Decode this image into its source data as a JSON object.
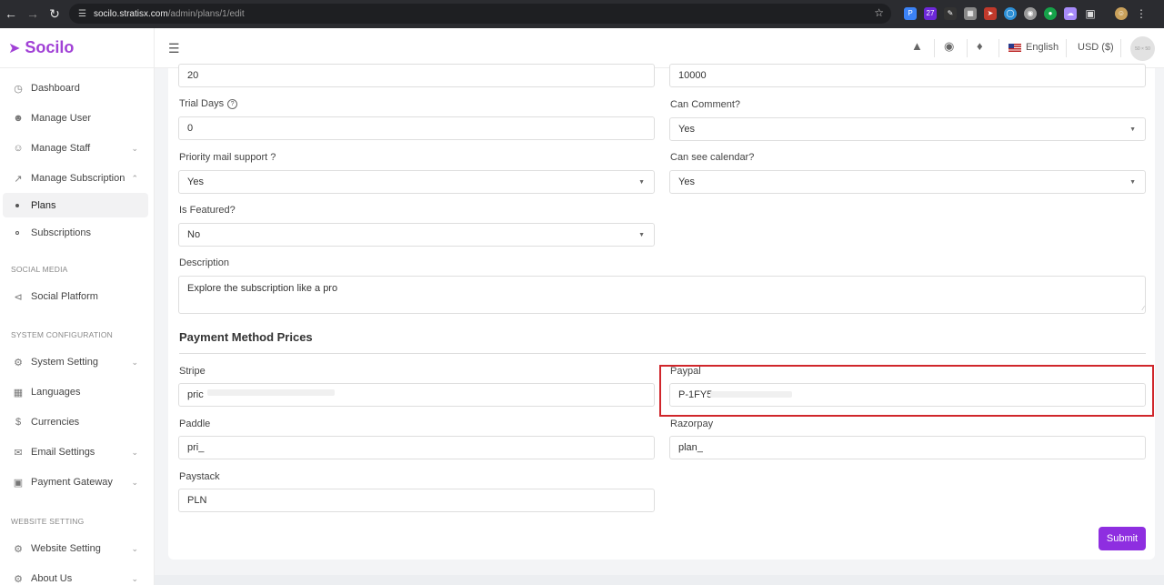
{
  "browser": {
    "url_host": "socilo.stratisx.com",
    "url_path": "/admin/plans/1/edit"
  },
  "brand": {
    "name": "Socilo",
    "accent": "#a141d6"
  },
  "sidebar": {
    "items": [
      {
        "label": "Dashboard",
        "icon": "dashboard-icon"
      },
      {
        "label": "Manage User",
        "icon": "user-icon"
      },
      {
        "label": "Manage Staff",
        "icon": "user-plus-icon"
      },
      {
        "label": "Manage Subscription",
        "icon": "chart-line-icon"
      }
    ],
    "subscription_children": [
      {
        "label": "Plans",
        "active": true
      },
      {
        "label": "Subscriptions",
        "active": false
      }
    ],
    "section_social": "SOCIAL MEDIA",
    "social_items": [
      {
        "label": "Social Platform",
        "icon": "share-icon"
      }
    ],
    "section_system": "SYSTEM CONFIGURATION",
    "system_items": [
      {
        "label": "System Setting",
        "icon": "gear-icon"
      },
      {
        "label": "Languages",
        "icon": "translate-icon"
      },
      {
        "label": "Currencies",
        "icon": "dollar-icon"
      },
      {
        "label": "Email Settings",
        "icon": "mail-icon"
      },
      {
        "label": "Payment Gateway",
        "icon": "card-icon"
      }
    ],
    "section_website": "WEBSITE SETTING",
    "website_items": [
      {
        "label": "Website Setting",
        "icon": "gear-icon"
      },
      {
        "label": "About Us",
        "icon": "gear-icon"
      }
    ]
  },
  "topbar": {
    "language": "English",
    "currency": "USD ($)",
    "avatar_text": "50 × 50"
  },
  "form": {
    "top_left_value": "20",
    "top_right_value": "10000",
    "trial_days_label": "Trial Days",
    "trial_days_value": "0",
    "can_comment_label": "Can Comment?",
    "can_comment_value": "Yes",
    "priority_mail_label": "Priority mail support ?",
    "priority_mail_value": "Yes",
    "can_see_calendar_label": "Can see calendar?",
    "can_see_calendar_value": "Yes",
    "is_featured_label": "Is Featured?",
    "is_featured_value": "No",
    "description_label": "Description",
    "description_value": "Explore the subscription like a pro"
  },
  "payment": {
    "title": "Payment Method Prices",
    "stripe_label": "Stripe",
    "stripe_value": "pric",
    "paypal_label": "Paypal",
    "paypal_value": "P-1FY5-",
    "paddle_label": "Paddle",
    "paddle_value": "pri_",
    "razorpay_label": "Razorpay",
    "razorpay_value": "plan_",
    "paystack_label": "Paystack",
    "paystack_value": "PLN"
  },
  "submit_label": "Submit",
  "colors": {
    "submit": "#8e2ee0",
    "highlight": "#d0262b"
  }
}
